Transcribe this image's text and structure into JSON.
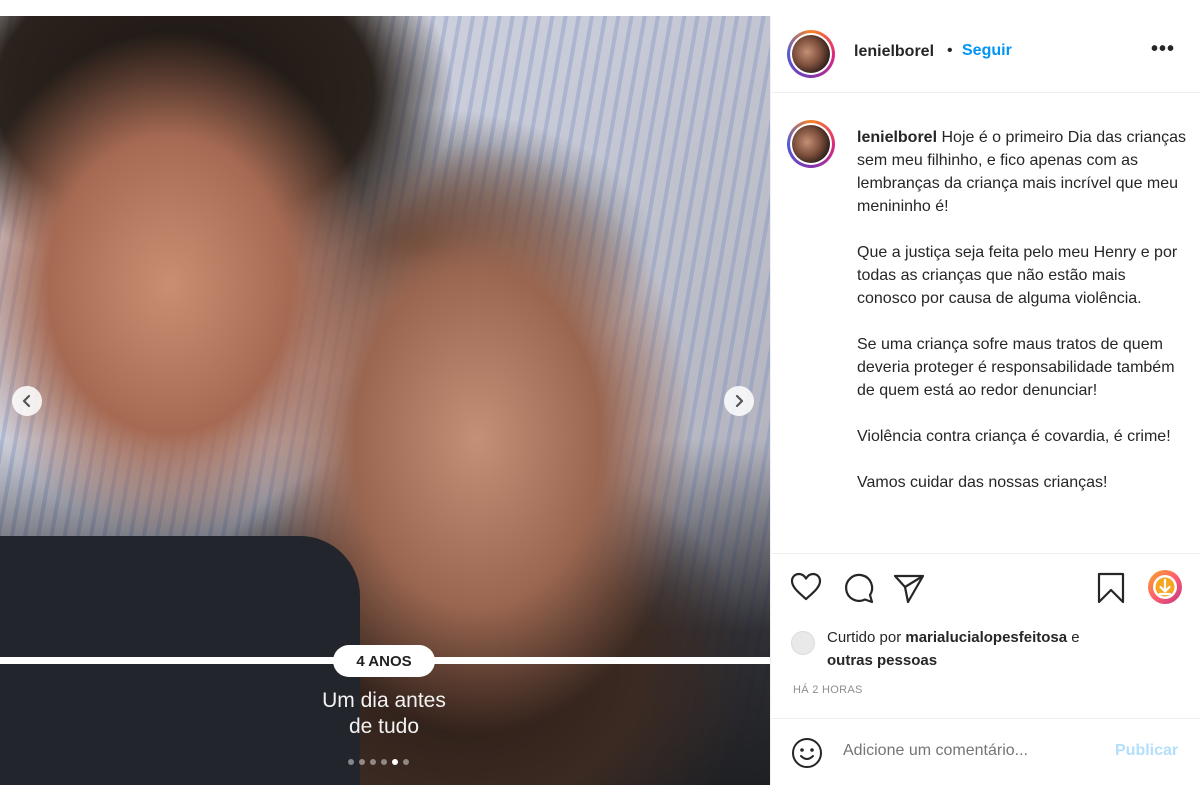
{
  "post": {
    "username": "lenielborel",
    "separator": "•",
    "follow_label": "Seguir",
    "more_label": "•••"
  },
  "image": {
    "age_badge": "4 ANOS",
    "tagline_line1": "Um dia antes",
    "tagline_line2": "de tudo",
    "carousel_count": 6,
    "carousel_active_index": 4
  },
  "caption": {
    "username": "lenielborel",
    "p1": "Hoje é o primeiro Dia das crianças sem meu filhinho, e fico apenas com as lembranças da criança mais incrível que meu menininho é!",
    "p2": "Que a justiça seja feita pelo meu Henry e por todas as crianças que não estão mais conosco por causa de alguma violência.",
    "p3": "Se uma criança sofre maus tratos de quem deveria proteger é responsabilidade também de quem está ao redor denunciar!",
    "p4": "Violência contra criança é covardia, é crime!",
    "p5": "Vamos cuidar das nossas crianças!"
  },
  "likes": {
    "prefix": "Curtido por",
    "user": "marialucialopesfeitosa",
    "connector": "e",
    "others": "outras pessoas"
  },
  "timestamp": "HÁ 2 HORAS",
  "comment": {
    "placeholder": "Adicione um comentário...",
    "publish_label": "Publicar"
  },
  "colors": {
    "follow": "#0095f6",
    "publish_disabled": "#b2dffc",
    "muted": "#8e8e8e"
  },
  "icons": [
    "chevron-left-icon",
    "chevron-right-icon",
    "heart-icon",
    "comment-icon",
    "share-icon",
    "bookmark-icon",
    "download-icon",
    "emoji-icon"
  ]
}
